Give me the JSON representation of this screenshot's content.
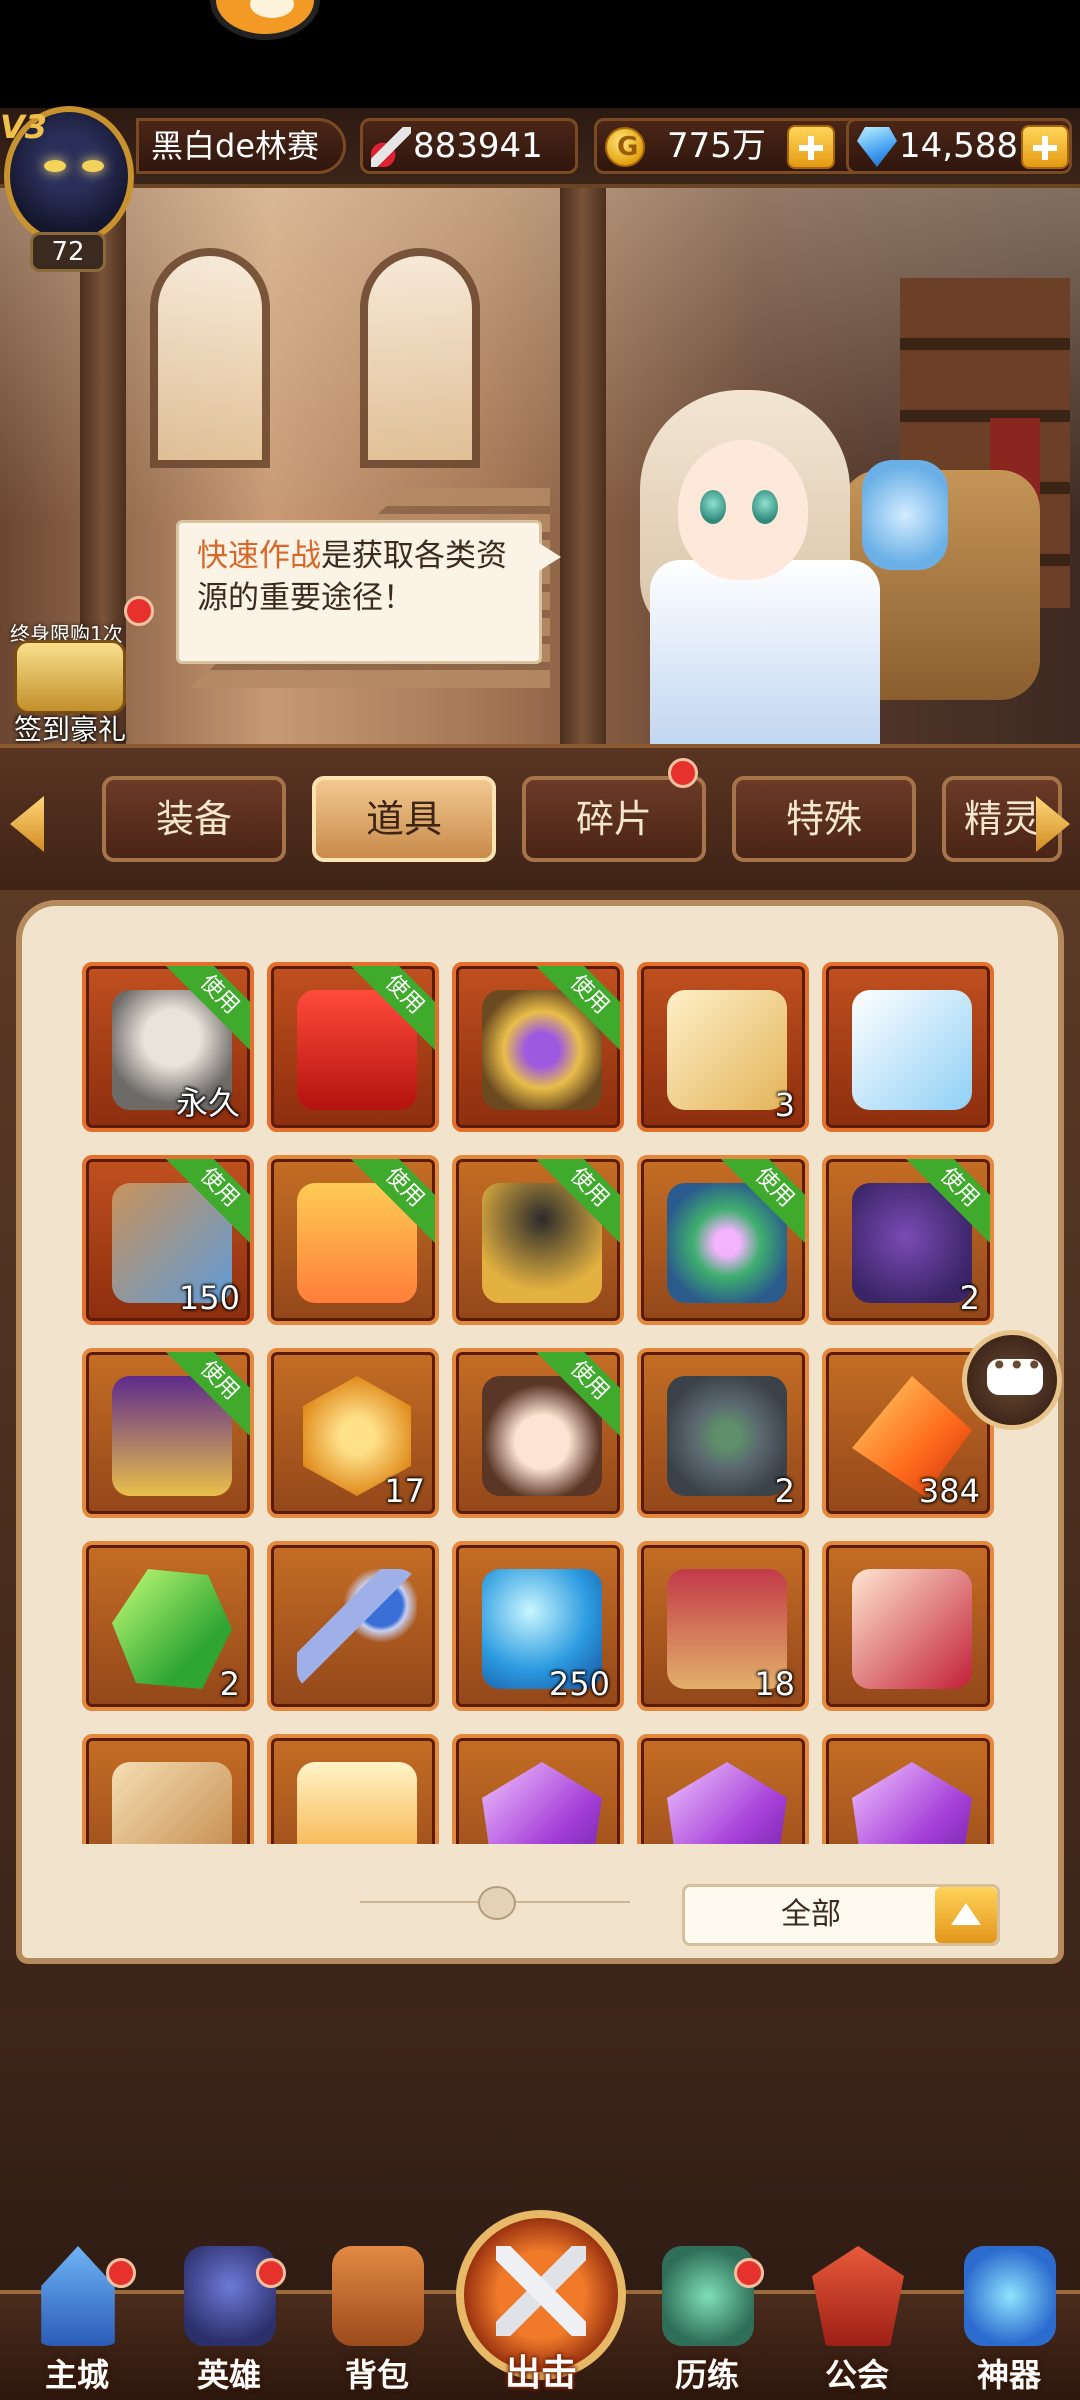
{
  "player": {
    "vip": "V3",
    "name": "黑白de林赛",
    "level": "72",
    "power": "883941",
    "gold": "775万",
    "diamonds": "14,588"
  },
  "banner": {
    "hint_highlight": "快速作战",
    "hint_text": "是获取各类资源的重要途径！",
    "gift_limit": "终身限购1次",
    "gift_label": "签到豪礼"
  },
  "tabs": [
    {
      "label": "装备"
    },
    {
      "label": "道具"
    },
    {
      "label": "碎片"
    },
    {
      "label": "特殊"
    },
    {
      "label": "精灵"
    }
  ],
  "items": [
    {
      "icon": "hero-portrait-icon",
      "qty": "永久",
      "use": "使用"
    },
    {
      "icon": "red-gift-box-icon",
      "qty": "",
      "use": "使用"
    },
    {
      "icon": "summon-card-icon",
      "qty": "",
      "use": "使用"
    },
    {
      "icon": "gold-scroll-icon",
      "qty": "3",
      "use": ""
    },
    {
      "icon": "blue-scroll-icon",
      "qty": "",
      "use": ""
    },
    {
      "icon": "scroll-ribbon-icon",
      "qty": "150",
      "use": "使用"
    },
    {
      "icon": "gift-pack-icon",
      "qty": "",
      "use": "使用"
    },
    {
      "icon": "dark-chest-icon",
      "qty": "",
      "use": "使用"
    },
    {
      "icon": "rainbow-card-icon",
      "qty": "",
      "use": "使用"
    },
    {
      "icon": "mystery-bag-icon",
      "qty": "2",
      "use": "使用"
    },
    {
      "icon": "purple-chest-icon",
      "qty": "",
      "use": "使用"
    },
    {
      "icon": "sun-coin-icon",
      "qty": "17",
      "use": ""
    },
    {
      "icon": "hero-girl-icon",
      "qty": "",
      "use": "使用"
    },
    {
      "icon": "rune-stone-icon",
      "qty": "2",
      "use": ""
    },
    {
      "icon": "fire-crystal-icon",
      "qty": "384",
      "use": ""
    },
    {
      "icon": "emerald-icon",
      "qty": "2",
      "use": ""
    },
    {
      "icon": "crystal-key-icon",
      "qty": "",
      "use": ""
    },
    {
      "icon": "water-orb-icon",
      "qty": "250",
      "use": ""
    },
    {
      "icon": "rose-scroll-icon",
      "qty": "18",
      "use": ""
    },
    {
      "icon": "red-scroll-icon",
      "qty": "",
      "use": ""
    },
    {
      "icon": "gold-scroll-2-icon",
      "qty": "",
      "use": ""
    },
    {
      "icon": "potion-icon",
      "qty": "",
      "use": ""
    },
    {
      "icon": "purple-rune-icon",
      "qty": "",
      "use": ""
    },
    {
      "icon": "purple-rune-icon",
      "qty": "",
      "use": ""
    },
    {
      "icon": "purple-rune-icon",
      "qty": "",
      "use": ""
    }
  ],
  "filter": {
    "label": "全部"
  },
  "nav": [
    {
      "label": "主城"
    },
    {
      "label": "英雄"
    },
    {
      "label": "背包"
    },
    {
      "label": "出击"
    },
    {
      "label": "历练"
    },
    {
      "label": "公会"
    },
    {
      "label": "神器"
    }
  ]
}
